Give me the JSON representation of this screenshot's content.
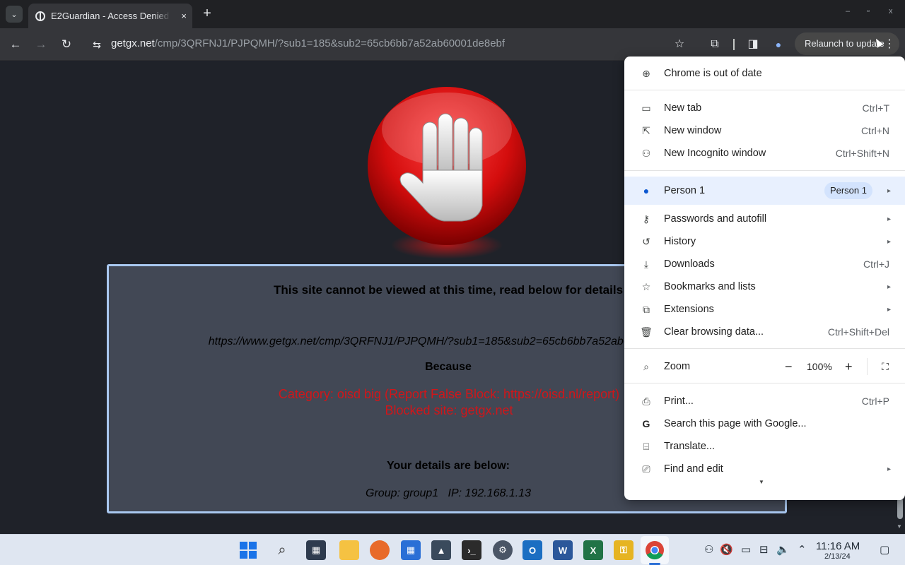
{
  "browser": {
    "tab": {
      "title": "E2Guardian - Access Denied",
      "close_icon": "×"
    },
    "new_tab": "+",
    "tab_search": "⌄",
    "window_controls": {
      "minimize": "–",
      "restore": "▫",
      "close": "x"
    },
    "toolbar": {
      "back": "←",
      "forward": "→",
      "reload": "↻",
      "site_info": "⇆",
      "url_host": "getgx.net",
      "url_path": "/cmp/3QRFNJ1/PJPQMH/?sub1=185&sub2=65cb6bb7a52ab60001de8ebf",
      "bookmark_star": "☆",
      "extensions": "⧉",
      "side_panel": "◨",
      "profile": "●",
      "relaunch_label": "Relaunch to update",
      "menu_dots": "⋮"
    }
  },
  "page": {
    "heading": "This site cannot be viewed at this time, read below for details",
    "blocked_url": "https://www.getgx.net/cmp/3QRFNJ1/PJPQMH/?sub1=185&sub2=65cb6bb7a52ab60001de8ebf",
    "because": "Because",
    "category": "Category: oisd big (Report False Block: https://oisd.nl/report)",
    "blocked_site": "Blocked site: getgx.net",
    "details_heading": "Your details are below:",
    "group_ip": "Group: group1   IP: 192.168.1.13"
  },
  "menu": {
    "out_of_date": "Chrome is out of date",
    "new_tab": {
      "label": "New tab",
      "shortcut": "Ctrl+T"
    },
    "new_window": {
      "label": "New window",
      "shortcut": "Ctrl+N"
    },
    "incognito": {
      "label": "New Incognito window",
      "shortcut": "Ctrl+Shift+N"
    },
    "person": {
      "label": "Person 1",
      "chip": "Person 1"
    },
    "passwords": {
      "label": "Passwords and autofill"
    },
    "history": {
      "label": "History"
    },
    "downloads": {
      "label": "Downloads",
      "shortcut": "Ctrl+J"
    },
    "bookmarks": {
      "label": "Bookmarks and lists"
    },
    "extensions": {
      "label": "Extensions"
    },
    "clear_data": {
      "label": "Clear browsing data...",
      "shortcut": "Ctrl+Shift+Del"
    },
    "zoom": {
      "label": "Zoom",
      "minus": "−",
      "value": "100%",
      "plus": "+",
      "fullscreen": "⛶"
    },
    "print": {
      "label": "Print...",
      "shortcut": "Ctrl+P"
    },
    "search_google": {
      "label": "Search this page with Google..."
    },
    "translate": {
      "label": "Translate..."
    },
    "find_edit": {
      "label": "Find and edit"
    },
    "submenu_arrow": "▸",
    "more_arrow": "▼"
  },
  "taskbar": {
    "clock_time": "11:16 AM",
    "clock_date": "2/13/24"
  },
  "colors": {
    "block_text_red": "#d0161a",
    "box_border": "#a9c8f0",
    "page_bg": "#1f2229"
  }
}
